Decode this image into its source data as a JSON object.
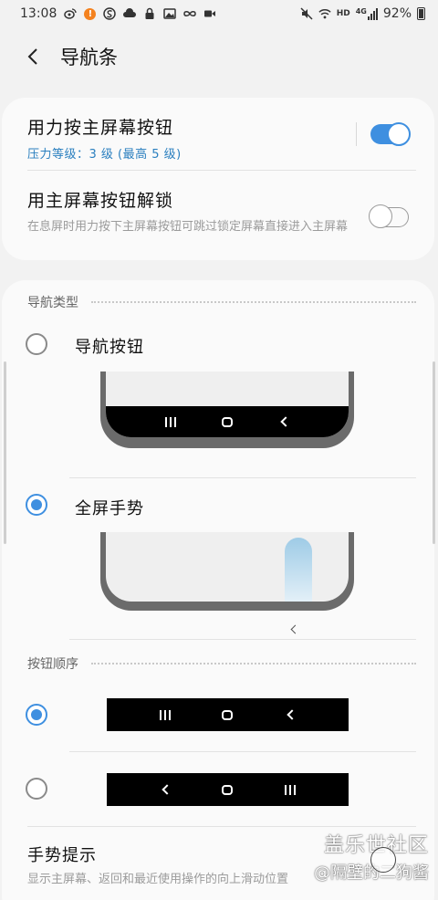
{
  "status_bar": {
    "time": "13:08",
    "network": "HD",
    "signal_gen": "4G",
    "battery_percent": "92%",
    "battery_level": 0.92,
    "icons_left": [
      "weibo-icon",
      "alert-icon",
      "s-icon",
      "cloud-icon",
      "lock-icon",
      "image-icon",
      "link-icon",
      "video-icon"
    ],
    "icons_right": [
      "mute-icon",
      "wifi-icon",
      "hd-icon",
      "signal-icon",
      "battery-icon"
    ]
  },
  "header": {
    "title": "导航条"
  },
  "settings": {
    "force_press": {
      "title": "用力按主屏幕按钮",
      "subtitle": "压力等级：3 级 (最高 5 级)",
      "enabled": true
    },
    "unlock_home": {
      "title": "用主屏幕按钮解锁",
      "subtitle": "在息屏时用力按下主屏幕按钮可跳过锁定屏幕直接进入主屏幕",
      "enabled": false
    }
  },
  "navigation_type": {
    "section_label": "导航类型",
    "options": [
      {
        "label": "导航按钮",
        "selected": false
      },
      {
        "label": "全屏手势",
        "selected": true
      }
    ]
  },
  "button_order": {
    "section_label": "按钮顺序",
    "options": [
      {
        "order": [
          "recent",
          "home",
          "back"
        ],
        "selected": true
      },
      {
        "order": [
          "back",
          "home",
          "recent"
        ],
        "selected": false
      }
    ]
  },
  "gesture_hint": {
    "title": "手势提示",
    "subtitle": "显示主屏幕、返回和最近使用操作的向上滑动位置"
  },
  "watermark": {
    "line1": "盖乐世社区",
    "line2": "@隔壁的二狗酱"
  },
  "colors": {
    "accent": "#3e8fe0",
    "subtitle_blue": "#2a7fbf",
    "background": "#f2f2f2",
    "card": "#fafafa"
  }
}
